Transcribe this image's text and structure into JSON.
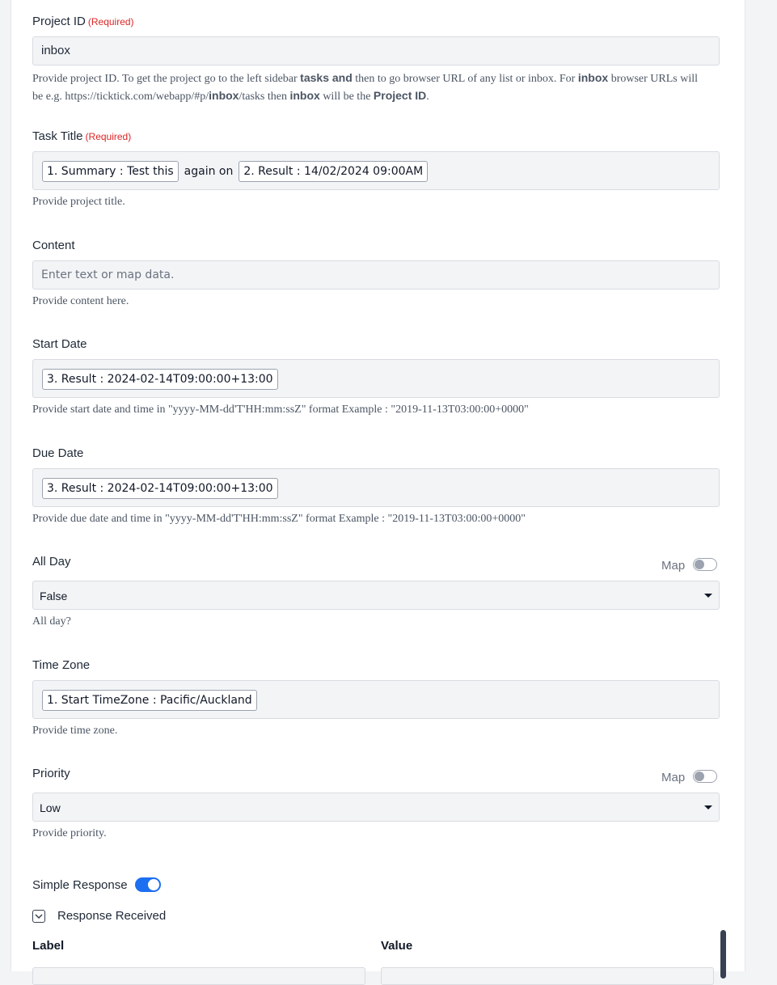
{
  "required_text": "(Required)",
  "project_id": {
    "label": "Project ID",
    "value": "inbox",
    "help": {
      "t1": "Provide project ID. To get the project go to the left sidebar ",
      "b1": "tasks and",
      "t2": " then to go browser URL of any list or inbox. For ",
      "b2": "inbox",
      "t3": " browser URLs will be e.g. https://ticktick.com/webapp/#p/",
      "b3": "inbox",
      "t4": "/tasks then ",
      "b4": "inbox",
      "t5": " will be the ",
      "b5": "Project ID",
      "t6": "."
    }
  },
  "task_title": {
    "label": "Task Title",
    "chip1": "1. Summary : Test this",
    "middle_text": "again on",
    "chip2": "2. Result : 14/02/2024 09:00AM",
    "help": "Provide project title."
  },
  "content": {
    "label": "Content",
    "placeholder": "Enter text or map data.",
    "help": "Provide content here."
  },
  "start_date": {
    "label": "Start Date",
    "chip": "3. Result : 2024-02-14T09:00:00+13:00",
    "help": "Provide start date and time in \"yyyy-MM-dd'T'HH:mm:ssZ\" format Example : \"2019-11-13T03:00:00+0000\""
  },
  "due_date": {
    "label": "Due Date",
    "chip": "3. Result : 2024-02-14T09:00:00+13:00",
    "help": "Provide due date and time in \"yyyy-MM-dd'T'HH:mm:ssZ\" format Example : \"2019-11-13T03:00:00+0000\""
  },
  "all_day": {
    "label": "All Day",
    "map_label": "Map",
    "map_enabled": false,
    "selected": "False",
    "help": "All day?"
  },
  "time_zone": {
    "label": "Time Zone",
    "chip": "1. Start TimeZone : Pacific/Auckland",
    "help": "Provide time zone."
  },
  "priority": {
    "label": "Priority",
    "map_label": "Map",
    "map_enabled": false,
    "selected": "Low",
    "help": "Provide priority."
  },
  "simple_response": {
    "label": "Simple Response",
    "enabled": true
  },
  "response_received": {
    "label": "Response Received",
    "col_label": "Label",
    "col_value": "Value"
  },
  "colors": {
    "accent": "#1d6ff2",
    "required": "#dc2626",
    "input_bg": "#f3f4f6"
  }
}
